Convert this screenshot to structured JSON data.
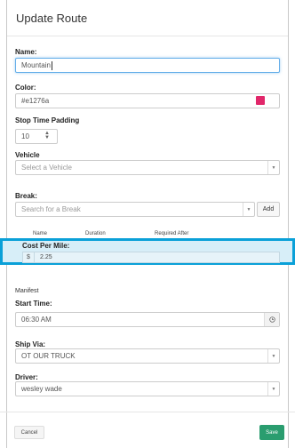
{
  "modal": {
    "title": "Update Route"
  },
  "form": {
    "name_label": "Name:",
    "name_value": "Mountain",
    "color_label": "Color:",
    "color_value": "#e1276a",
    "color_swatch": "#e1276a",
    "padding_label": "Stop Time Padding",
    "padding_value": "10",
    "vehicle_label": "Vehicle",
    "vehicle_placeholder": "Select a Vehicle",
    "break_label": "Break:",
    "break_placeholder": "Search for a Break",
    "add_label": "Add",
    "break_columns": [
      "Name",
      "Duration",
      "Required After"
    ],
    "cost_label": "Cost Per Mile:",
    "currency_symbol": "$",
    "cost_value": "2.25",
    "manifest_label": "Manifest",
    "start_time_label": "Start Time:",
    "start_time_value": "06:30 AM",
    "ship_via_label": "Ship Via:",
    "ship_via_value": "OT OUR TRUCK",
    "driver_label": "Driver:",
    "driver_value": "wesley wade"
  },
  "footer": {
    "cancel_label": "Cancel",
    "save_label": "Save"
  },
  "colors": {
    "accent_highlight": "#0aa0d8",
    "save_button": "#2a9d6f",
    "focus_border": "#66afe9"
  },
  "icons": {
    "clock": "clock-icon",
    "dropdown": "chevron-down-icon",
    "stepper": "stepper-icon"
  }
}
